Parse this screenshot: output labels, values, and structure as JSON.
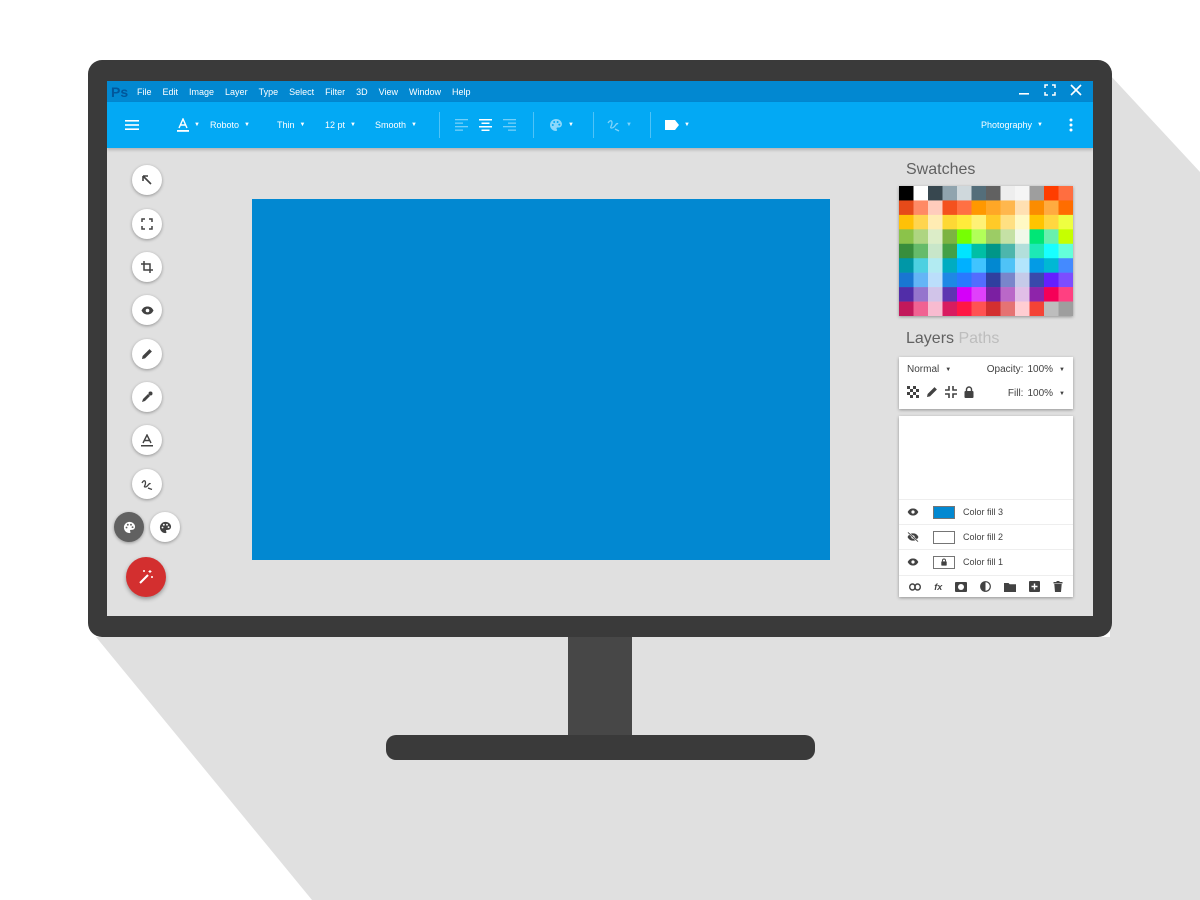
{
  "app": {
    "logo": "Ps"
  },
  "menu": [
    "File",
    "Edit",
    "Image",
    "Layer",
    "Type",
    "Select",
    "Filter",
    "3D",
    "View",
    "Window",
    "Help"
  ],
  "window_controls": [
    "minimize-icon",
    "fullscreen-icon",
    "close-icon"
  ],
  "toolbar": {
    "font_family": "Roboto",
    "font_weight": "Thin",
    "font_size": "12 pt",
    "antialias": "Smooth",
    "workspace": "Photography"
  },
  "tools": [
    "arrow-icon",
    "marquee-icon",
    "crop-icon",
    "eye-icon",
    "pencil-icon",
    "eyedropper-icon",
    "text-icon",
    "path-icon"
  ],
  "canvas": {
    "fill_color": "#0288d1"
  },
  "swatches": {
    "title": "Swatches",
    "rows": [
      [
        "#000000",
        "#ffffff",
        "#37474f",
        "#90a4ae",
        "#cfd8dc",
        "#546e7a",
        "#616161",
        "#eeeeee",
        "#f5f5f5",
        "#9e9e9e",
        "#ff3d00",
        "#ff6e40"
      ],
      [
        "#e64a19",
        "#ff8a65",
        "#ffccbc",
        "#f4511e",
        "#ff7043",
        "#ff9800",
        "#ffa726",
        "#ffb74d",
        "#ffe0b2",
        "#fb8c00",
        "#ffab40",
        "#ff6d00"
      ],
      [
        "#ffc107",
        "#ffd54f",
        "#ffecb3",
        "#fdd835",
        "#ffeb3b",
        "#fff176",
        "#ffca28",
        "#ffe082",
        "#fff9c4",
        "#ffc400",
        "#ffd740",
        "#eeff41"
      ],
      [
        "#8bc34a",
        "#aed581",
        "#dcedc8",
        "#7cb342",
        "#76ff03",
        "#b2ff59",
        "#9ccc65",
        "#c5e1a5",
        "#f1f8e9",
        "#00e676",
        "#69f0ae",
        "#c6ff00"
      ],
      [
        "#388e3c",
        "#66bb6a",
        "#c8e6c9",
        "#43a047",
        "#00e5ff",
        "#00bfa5",
        "#009688",
        "#4db6ac",
        "#b2dfdb",
        "#1de9b6",
        "#18ffff",
        "#64ffda"
      ],
      [
        "#0097a7",
        "#4dd0e1",
        "#b2ebf2",
        "#00acc1",
        "#00b0ff",
        "#40c4ff",
        "#0288d1",
        "#4fc3f7",
        "#b3e5fc",
        "#039be5",
        "#00b8d4",
        "#448aff"
      ],
      [
        "#1976d2",
        "#64b5f6",
        "#bbdefb",
        "#1e88e5",
        "#2979ff",
        "#536dfe",
        "#303f9f",
        "#7986cb",
        "#c5cae9",
        "#3949ab",
        "#651fff",
        "#7c4dff"
      ],
      [
        "#512da8",
        "#9575cd",
        "#d1c4e9",
        "#5e35b1",
        "#d500f9",
        "#e040fb",
        "#7b1fa2",
        "#ba68c8",
        "#e1bee7",
        "#8e24aa",
        "#f50057",
        "#ff4081"
      ],
      [
        "#c2185b",
        "#f06292",
        "#f8bbd0",
        "#d81b60",
        "#ff1744",
        "#ff5252",
        "#d32f2f",
        "#e57373",
        "#ffcdd2",
        "#f44336",
        "#bdbdbd",
        "#9e9e9e"
      ]
    ]
  },
  "layers": {
    "title": "Layers",
    "tab_paths": "Paths",
    "blend_mode": "Normal",
    "opacity_label": "Opacity:",
    "opacity_value": "100%",
    "fill_label": "Fill:",
    "fill_value": "100%",
    "items": [
      {
        "name": "Color fill 3",
        "visible": true,
        "thumb": "#0288d1"
      },
      {
        "name": "Color fill 2",
        "visible": false,
        "thumb": "#ffffff"
      },
      {
        "name": "Color fill 1",
        "visible": true,
        "thumb": "#ffffff",
        "locked": true
      }
    ],
    "footer_fx": "fx"
  }
}
